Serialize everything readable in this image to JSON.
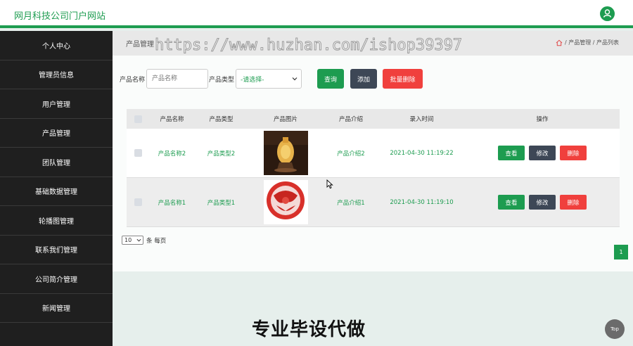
{
  "header": {
    "site_title": "网月科技公司门户网站",
    "user_icon": "user-icon"
  },
  "sidebar": {
    "items": [
      {
        "label": "个人中心"
      },
      {
        "label": "管理员信息"
      },
      {
        "label": "用户管理"
      },
      {
        "label": "产品管理"
      },
      {
        "label": "团队管理"
      },
      {
        "label": "基础数据管理"
      },
      {
        "label": "轮播图管理"
      },
      {
        "label": "联系我们管理"
      },
      {
        "label": "公司简介管理"
      },
      {
        "label": "新闻管理"
      }
    ]
  },
  "breadcrumb": {
    "page_heading": "产品管理",
    "home_icon": "home-icon",
    "path": "/ 产品管理 / 产品列表"
  },
  "watermark": "https://www.huzhan.com/ishop39397",
  "search": {
    "name_label": "产品名称",
    "name_placeholder": "产品名称",
    "type_label": "产品类型",
    "type_selected": "-请选择-",
    "query_button": "查询",
    "add_button": "添加",
    "batch_delete_button": "批量删除"
  },
  "table": {
    "headers": [
      "产品名称",
      "产品类型",
      "产品图片",
      "产品介绍",
      "录入时间",
      "操作"
    ],
    "rows": [
      {
        "name": "产品名称2",
        "type": "产品类型2",
        "image": "vase-image",
        "intro": "产品介绍2",
        "time": "2021-04-30 11:19:22"
      },
      {
        "name": "产品名称1",
        "type": "产品类型1",
        "image": "paper-cut-image",
        "intro": "产品介绍1",
        "time": "2021-04-30 11:19:10"
      }
    ],
    "actions": {
      "view": "查看",
      "edit": "修改",
      "delete": "删除"
    }
  },
  "pagination": {
    "per_page": "10",
    "per_page_label": "条 每页",
    "current_page": "1"
  },
  "promo_text": "专业毕设代做",
  "top_button": "Top",
  "colors": {
    "accent": "#1d9c50",
    "danger": "#f0403d",
    "dark": "#3d4756",
    "sidebar": "#1f1f1f"
  }
}
